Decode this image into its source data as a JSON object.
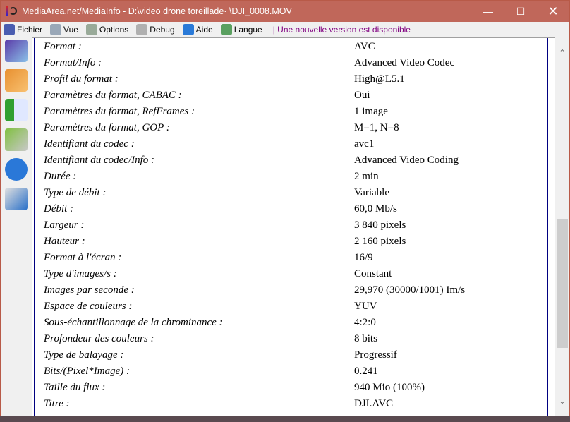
{
  "window": {
    "title": "MediaArea.net/MediaInfo - D:\\video drone toreillade· \\DJI_0008.MOV"
  },
  "menu": [
    {
      "label": "Fichier",
      "icon": "file-music-icon",
      "color": "#4a5db0"
    },
    {
      "label": "Vue",
      "icon": "view-icon",
      "color": "#9aa8b8"
    },
    {
      "label": "Options",
      "icon": "options-icon",
      "color": "#9a9"
    },
    {
      "label": "Debug",
      "icon": "debug-icon",
      "color": "#b0b0b0"
    },
    {
      "label": "Aide",
      "icon": "help-icon",
      "color": "#2a7ad8"
    },
    {
      "label": "Langue",
      "icon": "globe-icon",
      "color": "#5aa060"
    }
  ],
  "update_notice": "| Une nouvelle version est disponible",
  "rows": [
    [
      "Format :",
      "AVC"
    ],
    [
      "Format/Info :",
      "Advanced Video Codec"
    ],
    [
      "Profil du format :",
      "High@L5.1"
    ],
    [
      "Paramètres du format, CABAC :",
      "Oui"
    ],
    [
      "Paramètres du format, RefFrames :",
      "1 image"
    ],
    [
      "Paramètres du format, GOP :",
      "M=1, N=8"
    ],
    [
      "Identifiant du codec :",
      "avc1"
    ],
    [
      "Identifiant du codec/Info :",
      "Advanced Video Coding"
    ],
    [
      "Durée :",
      "2 min"
    ],
    [
      "Type de débit :",
      "Variable"
    ],
    [
      "Débit :",
      "60,0 Mb/s"
    ],
    [
      "Largeur :",
      "3 840 pixels"
    ],
    [
      "Hauteur :",
      "2 160 pixels"
    ],
    [
      "Format à l'écran :",
      "16/9"
    ],
    [
      "Type d'images/s :",
      "Constant"
    ],
    [
      "Images par seconde :",
      "29,970 (30000/1001) Im/s"
    ],
    [
      "Espace de couleurs :",
      "YUV"
    ],
    [
      "Sous-échantillonnage de la chrominance :",
      "4:2:0"
    ],
    [
      "Profondeur des couleurs :",
      "8 bits"
    ],
    [
      "Type de balayage :",
      "Progressif"
    ],
    [
      "Bits/(Pixel*Image) :",
      "0.241"
    ],
    [
      "Taille du flux :",
      "940 Mio (100%)"
    ],
    [
      "Titre :",
      "DJI.AVC"
    ]
  ],
  "scroll": {
    "position_fraction": 0.47,
    "visible_fraction": 0.36
  }
}
